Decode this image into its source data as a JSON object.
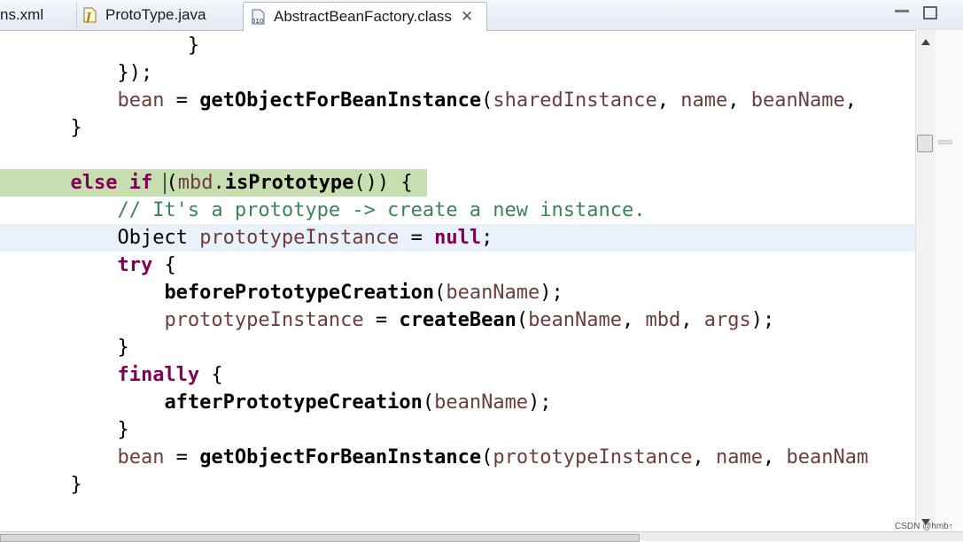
{
  "tabs": [
    {
      "label": "ns.xml",
      "icon": "xml-file-icon"
    },
    {
      "label": "ProtoType.java",
      "icon": "java-file-icon"
    },
    {
      "label": "AbstractBeanFactory.class",
      "icon": "class-file-icon",
      "active": true
    }
  ],
  "code": {
    "l1": "}",
    "l2": "});",
    "l3_var": "bean",
    "l3_eq": " = ",
    "l3_fn": "getObjectForBeanInstance",
    "l3_open": "(",
    "l3_a1": "sharedInstance",
    "l3_sep1": ", ",
    "l3_a2": "name",
    "l3_sep2": ", ",
    "l3_a3": "beanName",
    "l3_tail": ", ",
    "l4": "}",
    "l5_kw": "else if",
    "l5_open": "(",
    "l5_var": "mbd",
    "l5_dot": ".",
    "l5_fn": "isPrototype",
    "l5_tail": "()) {",
    "l6": "// It's a prototype -> create a new instance.",
    "l7_type": "Object",
    "l7_var": "prototypeInstance",
    "l7_eq": " = ",
    "l7_kw": "null",
    "l7_end": ";",
    "l8_kw": "try",
    "l8_end": " {",
    "l9_fn": "beforePrototypeCreation",
    "l9_open": "(",
    "l9_var": "beanName",
    "l9_end": ");",
    "l10_var": "prototypeInstance",
    "l10_eq": " = ",
    "l10_fn": "createBean",
    "l10_open": "(",
    "l10_a1": "beanName",
    "l10_s1": ", ",
    "l10_a2": "mbd",
    "l10_s2": ", ",
    "l10_a3": "args",
    "l10_end": ");",
    "l11": "}",
    "l12_kw": "finally",
    "l12_end": " {",
    "l13_fn": "afterPrototypeCreation",
    "l13_open": "(",
    "l13_var": "beanName",
    "l13_end": ");",
    "l14": "}",
    "l15_var": "bean",
    "l15_eq": " = ",
    "l15_fn": "getObjectForBeanInstance",
    "l15_open": "(",
    "l15_a1": "prototypeInstance",
    "l15_s1": ", ",
    "l15_a2": "name",
    "l15_s2": ", ",
    "l15_a3": "beanNam",
    "l16": "}"
  },
  "watermark": "CSDN @hmb↑",
  "colors": {
    "keyword": "#7f0055",
    "variable": "#6a3e3e",
    "comment": "#3f7f5f",
    "line_highlight": "#c7dfb0"
  }
}
